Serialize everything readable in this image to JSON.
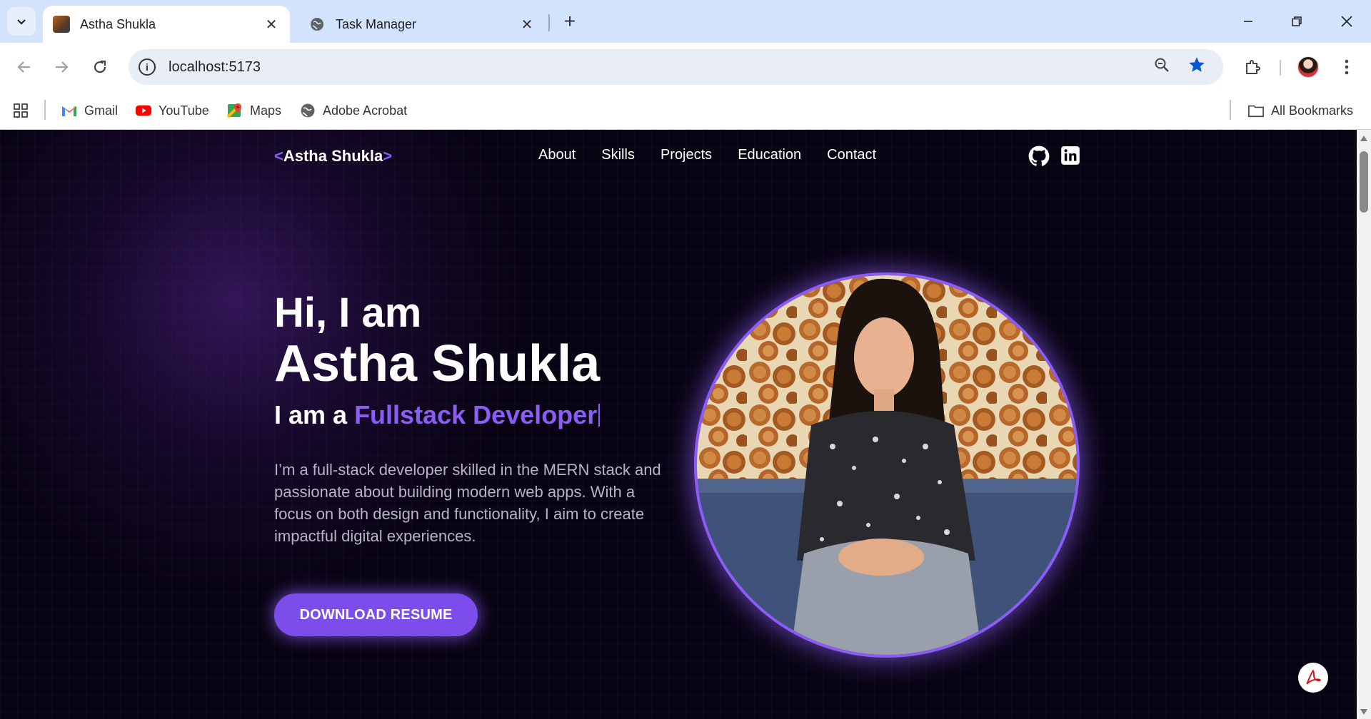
{
  "browser": {
    "tabs": [
      {
        "title": "Astha Shukla",
        "active": true
      },
      {
        "title": "Task Manager",
        "active": false
      }
    ],
    "new_tab_label": "+",
    "close_label": "✕",
    "url": "localhost:5173",
    "bookmarks": [
      {
        "label": "Gmail",
        "icon": "gmail-icon"
      },
      {
        "label": "YouTube",
        "icon": "youtube-icon"
      },
      {
        "label": "Maps",
        "icon": "maps-icon"
      },
      {
        "label": "Adobe Acrobat",
        "icon": "globe-icon"
      }
    ],
    "all_bookmarks_label": "All Bookmarks",
    "accent_color": "#0b57d0"
  },
  "site": {
    "logo": {
      "open": "<",
      "name": "Astha Shukla",
      "close": ">"
    },
    "nav": [
      "About",
      "Skills",
      "Projects",
      "Education",
      "Contact"
    ],
    "social": [
      "github-icon",
      "linkedin-icon"
    ],
    "hero": {
      "greeting": "Hi, I am",
      "name": "Astha Shukla",
      "role_prefix": "I am a ",
      "role_highlight": "Fullstack Developer",
      "description": "I’m a full-stack developer skilled in the MERN stack and passionate about building modern web apps. With a focus on both design and functionality, I aim to create impactful digital experiences.",
      "resume_button": "DOWNLOAD RESUME"
    },
    "colors": {
      "accent": "#8b5cf6",
      "background": "#080413"
    }
  }
}
